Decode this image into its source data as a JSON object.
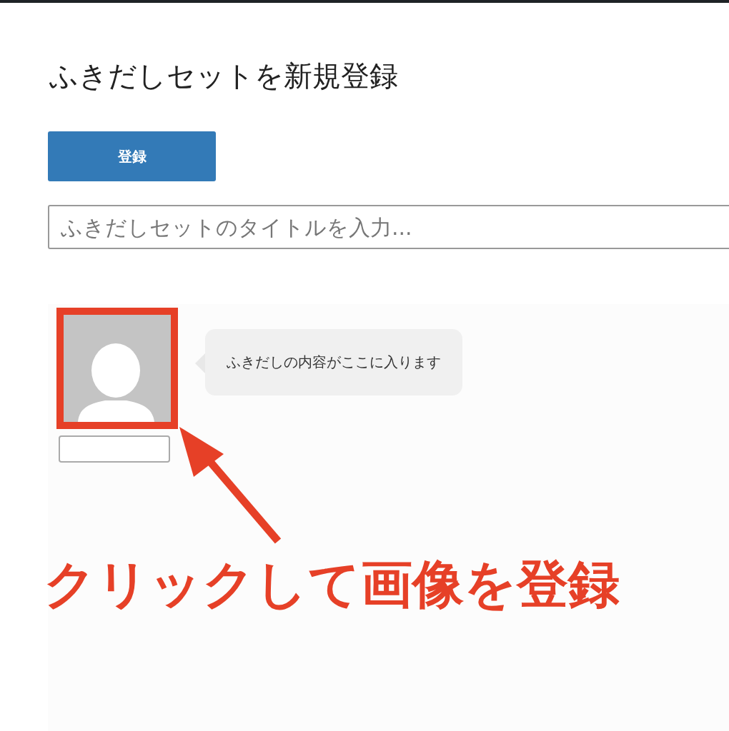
{
  "page": {
    "title": "ふきだしセットを新規登録"
  },
  "register_button": {
    "label": "登録"
  },
  "title_field": {
    "placeholder": "ふきだしセットのタイトルを入力..."
  },
  "balloon": {
    "text": "ふきだしの内容がここに入ります"
  },
  "annotation": {
    "text": "クリックして画像を登録"
  }
}
